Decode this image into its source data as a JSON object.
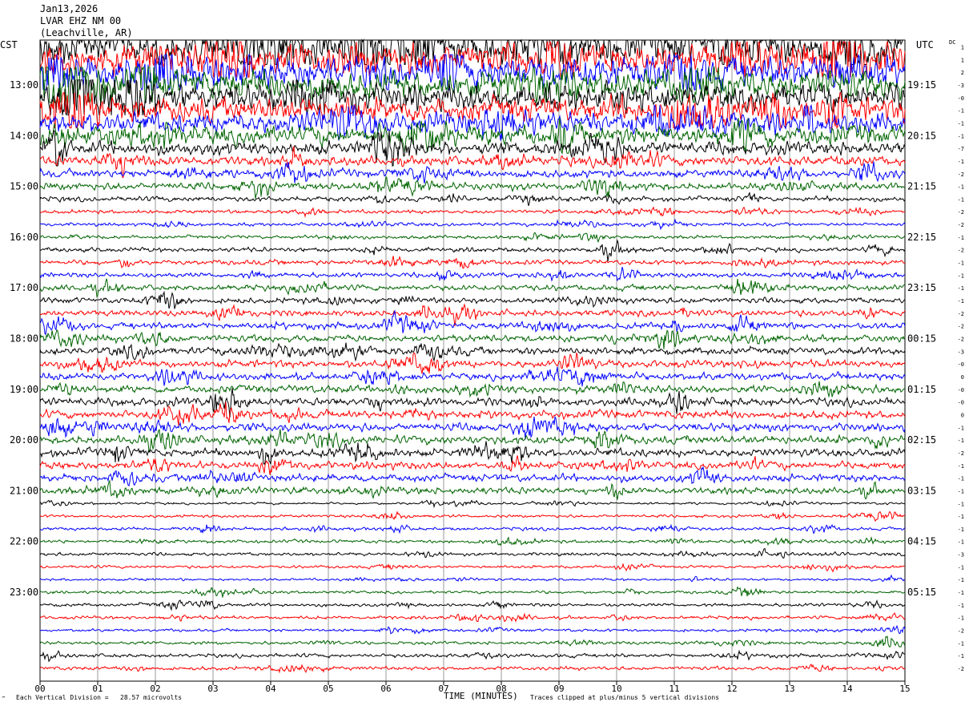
{
  "header": {
    "date": "Jan13,2026",
    "station": "LVAR EHZ NM 00",
    "location": "(Leachville, AR)"
  },
  "left_tz": "CST",
  "right_tz": "UTC",
  "dc_label": "DC",
  "footer": {
    "scale_note": "Each Vertical Division =   28.57 microvolts",
    "clip_note": "Traces clipped at plus/minus 5 vertical divisions",
    "corner_mark": "‴"
  },
  "chart_data": {
    "type": "line",
    "title": "",
    "xlabel": "TIME (MINUTES)",
    "xlim": [
      0,
      15
    ],
    "x_ticks": [
      "00",
      "01",
      "02",
      "03",
      "04",
      "05",
      "06",
      "07",
      "08",
      "09",
      "10",
      "11",
      "12",
      "13",
      "14",
      "15"
    ],
    "trace_colors": [
      "#000000",
      "#ff0000",
      "#0000ff",
      "#006400"
    ],
    "rows_per_hour": 4,
    "row_minutes": 15,
    "start_local": "12:15",
    "left_hour_labels": [
      "13:00",
      "14:00",
      "15:00",
      "16:00",
      "17:00",
      "18:00",
      "19:00",
      "20:00",
      "21:00",
      "22:00",
      "23:00"
    ],
    "right_hour_labels": [
      "19:15",
      "20:15",
      "21:15",
      "22:15",
      "23:15",
      "00:15",
      "01:15",
      "02:15",
      "03:15",
      "04:15",
      "05:15"
    ],
    "dc_offsets": [
      "1",
      "1",
      "2",
      "-3",
      "-0",
      "-1",
      "-1",
      "-1",
      "-7",
      "-1",
      "-2",
      "-1",
      "-1",
      "-2",
      "-2",
      "-1",
      "-2",
      "-1",
      "-1",
      "-1",
      "-1",
      "-2",
      "-2",
      "-2",
      "-3",
      "-0",
      "0",
      "-0",
      "-0",
      "0",
      "-1",
      "-1",
      "-2",
      "-1",
      "-1",
      "-1",
      "-1",
      "-1",
      "-1",
      "-1",
      "-3",
      "-1",
      "-1",
      "-1",
      "-1",
      "-1",
      "-2",
      "-1",
      "-1",
      "-2"
    ],
    "trace_rms_divisions": [
      4.6,
      4.2,
      3.8,
      3.6,
      3.4,
      3.0,
      2.6,
      2.4,
      1.6,
      1.2,
      1.0,
      0.9,
      0.6,
      0.45,
      0.4,
      0.42,
      0.55,
      0.6,
      0.6,
      0.7,
      0.7,
      0.75,
      0.8,
      0.85,
      0.9,
      0.9,
      0.9,
      0.95,
      1.0,
      1.0,
      1.0,
      1.0,
      1.0,
      0.95,
      0.9,
      0.85,
      0.3,
      0.35,
      0.4,
      0.4,
      0.4,
      0.35,
      0.3,
      0.35,
      0.4,
      0.4,
      0.35,
      0.4,
      0.45,
      0.45
    ],
    "clip_divisions": 5
  }
}
